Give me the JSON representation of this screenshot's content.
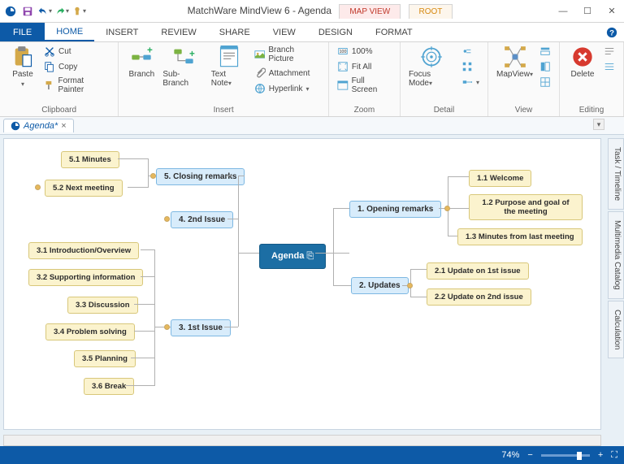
{
  "app": {
    "title": "MatchWare MindView 6 - Agenda",
    "context_tabs": {
      "mapview": "MAP VIEW",
      "root": "ROOT"
    }
  },
  "tabs": {
    "file": "FILE",
    "items": [
      "HOME",
      "INSERT",
      "REVIEW",
      "SHARE",
      "VIEW",
      "DESIGN",
      "FORMAT"
    ],
    "active": "HOME"
  },
  "ribbon": {
    "clipboard": {
      "label": "Clipboard",
      "paste": "Paste",
      "cut": "Cut",
      "copy": "Copy",
      "format_painter": "Format Painter"
    },
    "insert": {
      "label": "Insert",
      "branch": "Branch",
      "sub_branch": "Sub-Branch",
      "text_note": "Text Note",
      "branch_picture": "Branch Picture",
      "attachment": "Attachment",
      "hyperlink": "Hyperlink"
    },
    "zoom": {
      "label": "Zoom",
      "p100": "100%",
      "fit_all": "Fit All",
      "full_screen": "Full Screen"
    },
    "detail": {
      "label": "Detail",
      "focus": "Focus Mode"
    },
    "view": {
      "label": "View",
      "mapview": "MapView"
    },
    "editing": {
      "label": "Editing",
      "delete": "Delete"
    }
  },
  "document": {
    "tab_name": "Agenda*"
  },
  "sidetabs": [
    "Task / Timeline",
    "Multimedia Catalog",
    "Calculation"
  ],
  "status": {
    "zoom": "74%"
  },
  "map": {
    "root": "Agenda",
    "n1": "1.  Opening remarks",
    "n1_1": "1.1  Welcome",
    "n1_2": "1.2  Purpose and goal of the meeting",
    "n1_3": "1.3  Minutes from last meeting",
    "n2": "2.  Updates",
    "n2_1": "2.1  Update on 1st issue",
    "n2_2": "2.2  Update on 2nd issue",
    "n3": "3.  1st Issue",
    "n3_1": "3.1  Introduction/Overview",
    "n3_2": "3.2  Supporting information",
    "n3_3": "3.3  Discussion",
    "n3_4": "3.4  Problem solving",
    "n3_5": "3.5  Planning",
    "n3_6": "3.6  Break",
    "n4": "4.  2nd Issue",
    "n5": "5.  Closing remarks",
    "n5_1": "5.1  Minutes",
    "n5_2": "5.2  Next meeting"
  }
}
